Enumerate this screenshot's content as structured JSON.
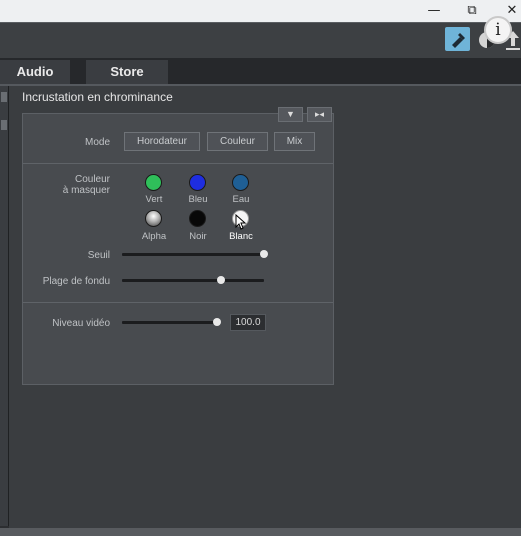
{
  "window": {
    "minimize_icon": "—",
    "restore_icon": "⧉",
    "close_icon": "✕",
    "info_icon": "i"
  },
  "tabs": [
    {
      "label": "Audio"
    },
    {
      "label": "Store"
    }
  ],
  "pane": {
    "title": "Incrustation en chrominance"
  },
  "header_buttons": {
    "dropdown_icon": "▼",
    "collapse_icon": "▸◂"
  },
  "mode": {
    "label": "Mode",
    "options": [
      "Horodateur",
      "Couleur",
      "Mix"
    ]
  },
  "color_mask": {
    "label_line1": "Couleur",
    "label_line2": "à masquer",
    "swatches": [
      {
        "label": "Vert",
        "color": "#2fbf5a"
      },
      {
        "label": "Bleu",
        "color": "#1e2de0"
      },
      {
        "label": "Eau",
        "color": "#1f5f95"
      },
      {
        "label": "Alpha",
        "color": "#c8c8c8"
      },
      {
        "label": "Noir",
        "color": "#080808"
      },
      {
        "label": "Blanc",
        "color": "#f5f5f5"
      }
    ]
  },
  "sliders": {
    "seuil": {
      "label": "Seuil",
      "value": 1.0
    },
    "plage": {
      "label": "Plage de fondu",
      "value": 0.7
    },
    "niveau": {
      "label": "Niveau vidéo",
      "value": 1.0,
      "display": "100.0"
    }
  },
  "colors": {
    "accent": "#6fb4d8"
  }
}
